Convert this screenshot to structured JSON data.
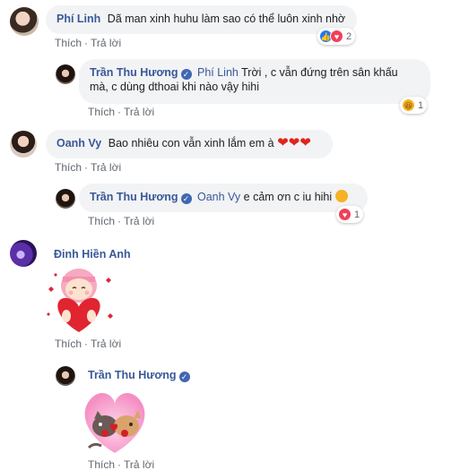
{
  "actions": {
    "like": "Thích",
    "reply": "Trả lời",
    "sep": "·"
  },
  "comments": [
    {
      "name": "Phí Linh",
      "text": "Dã man xinh huhu làm sao có thể luôn xinh nhờ",
      "reaction_count": "2"
    },
    {
      "name": "Trần Thu Hương",
      "tag": "Phí Linh",
      "text_line1": " Trời , c vẫn đứng trên sân khấu",
      "text_line2": "mà, c dùng dthoai khi nào vậy hihi",
      "reaction_count": "1"
    },
    {
      "name": "Oanh Vy",
      "text": "Bao nhiêu con vẫn xinh lắm em à",
      "hearts": "❤❤❤"
    },
    {
      "name": "Trần Thu Hương",
      "tag": "Oanh Vy",
      "text": " e cảm ơn c iu hihi",
      "reaction_count": "1"
    },
    {
      "name": "Đinh Hiền Anh",
      "sticker": "girl-hugging-heart-sticker"
    },
    {
      "name": "Trần Thu Hương",
      "sticker": "cats-kissing-heart-sticker"
    }
  ],
  "icons": {
    "like": "like-icon",
    "love": "love-icon",
    "haha": "haha-icon",
    "verified": "verified-badge-icon"
  },
  "colors": {
    "name": "#385898",
    "bubble": "#f2f3f5",
    "meta": "#606770",
    "like": "#2078f4",
    "love": "#f33e58",
    "heart": "#e0251b"
  }
}
